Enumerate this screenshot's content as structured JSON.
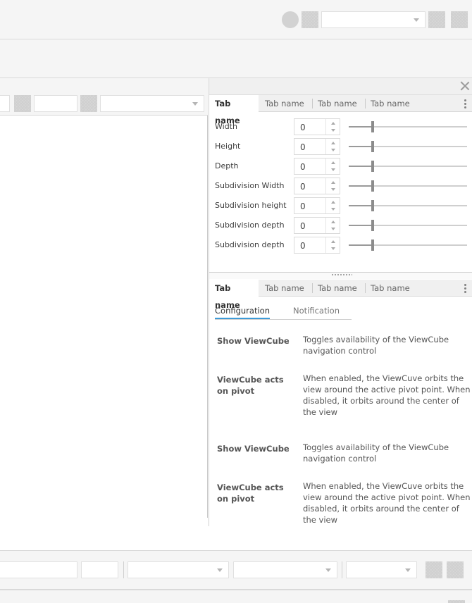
{
  "right_panel": {
    "top_tabs": [
      {
        "label": "Tab name",
        "active": true
      },
      {
        "label": "Tab name",
        "active": false
      },
      {
        "label": "Tab name",
        "active": false
      },
      {
        "label": "Tab name",
        "active": false
      }
    ],
    "properties": [
      {
        "label": "Width",
        "value": "0"
      },
      {
        "label": "Height",
        "value": "0"
      },
      {
        "label": "Depth",
        "value": "0"
      },
      {
        "label": "Subdivision Width",
        "value": "0"
      },
      {
        "label": "Subdivision height",
        "value": "0"
      },
      {
        "label": "Subdivision depth",
        "value": "0"
      },
      {
        "label": "Subdivision depth",
        "value": "0"
      }
    ],
    "slider_level": 0.2,
    "bottom_tabs": [
      {
        "label": "Tab name",
        "active": true
      },
      {
        "label": "Tab name",
        "active": false
      },
      {
        "label": "Tab name",
        "active": false
      },
      {
        "label": "Tab name",
        "active": false
      }
    ],
    "subtabs": {
      "configuration": "Configuration",
      "notification": "Notification"
    },
    "settings": [
      {
        "name": "Show ViewCube",
        "description": "Toggles availability of the ViewCube navigation control"
      },
      {
        "name": "ViewCube acts on pivot",
        "description": "When enabled, the ViewCuve orbits the view around the active pivot point. When disabled, it orbits around the center of the view"
      },
      {
        "name": "Show ViewCube",
        "description": "Toggles availability of the ViewCube navigation control"
      },
      {
        "name": "ViewCube acts on pivot",
        "description": "When enabled, the ViewCuve orbits the view around the active pivot point. When disabled, it orbits around the center of the view"
      }
    ]
  },
  "colors": {
    "accent": "#3d9bd8",
    "toolbar_bg": "#f5f5f5",
    "placeholder": "#d7d7d7"
  },
  "icons": {
    "close": "close-icon",
    "more": "kebab-menu-icon",
    "dropdown": "chevron-down-icon",
    "avatar": "avatar-icon"
  }
}
